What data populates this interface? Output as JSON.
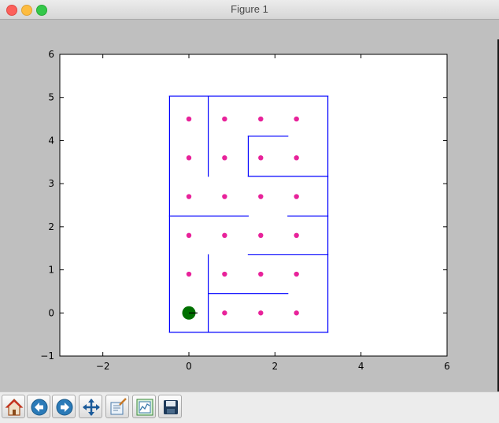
{
  "window": {
    "title": "Figure 1",
    "controls": [
      "close-button",
      "minimize-button",
      "zoom-button"
    ]
  },
  "chart_data": {
    "type": "scatter",
    "xlim": [
      -3,
      6
    ],
    "ylim": [
      -1,
      6
    ],
    "x_ticks": [
      -2,
      0,
      2,
      4,
      6
    ],
    "y_ticks": [
      -1,
      0,
      1,
      2,
      3,
      4,
      5,
      6
    ],
    "x_tick_labels": [
      "−2",
      "0",
      "2",
      "4",
      "6"
    ],
    "y_tick_labels": [
      "−1",
      "0",
      "1",
      "2",
      "3",
      "4",
      "5",
      "6"
    ],
    "grid": false,
    "points": {
      "color": "#e8229a",
      "x": [
        0,
        0.83,
        1.67,
        2.5
      ],
      "y": [
        0,
        0.9,
        1.8,
        2.7,
        3.6,
        4.5
      ],
      "omitted": [
        [
          0,
          0
        ]
      ]
    },
    "agent": {
      "x": 0,
      "y": 0,
      "color": "#007000",
      "heading": [
        0.2,
        0
      ]
    },
    "walls": {
      "color": "#0000ff",
      "segments": [
        [
          [
            -0.45,
            -0.45
          ],
          [
            3.23,
            -0.45
          ]
        ],
        [
          [
            3.23,
            -0.45
          ],
          [
            3.23,
            5.03
          ]
        ],
        [
          [
            3.23,
            5.03
          ],
          [
            -0.45,
            5.03
          ]
        ],
        [
          [
            -0.45,
            5.03
          ],
          [
            -0.45,
            -0.45
          ]
        ],
        [
          [
            0.45,
            5.03
          ],
          [
            0.45,
            3.17
          ]
        ],
        [
          [
            1.38,
            4.1
          ],
          [
            2.3,
            4.1
          ]
        ],
        [
          [
            1.38,
            4.1
          ],
          [
            1.38,
            3.17
          ]
        ],
        [
          [
            1.38,
            3.17
          ],
          [
            3.23,
            3.17
          ]
        ],
        [
          [
            -0.45,
            2.25
          ],
          [
            1.38,
            2.25
          ]
        ],
        [
          [
            2.3,
            2.25
          ],
          [
            3.23,
            2.25
          ]
        ],
        [
          [
            1.38,
            1.35
          ],
          [
            3.23,
            1.35
          ]
        ],
        [
          [
            0.45,
            1.35
          ],
          [
            0.45,
            -0.45
          ]
        ],
        [
          [
            0.45,
            0.45
          ],
          [
            2.3,
            0.45
          ]
        ]
      ]
    }
  },
  "toolbar": {
    "buttons": [
      {
        "name": "home-button",
        "icon": "home-icon"
      },
      {
        "name": "back-button",
        "icon": "back-arrow-icon"
      },
      {
        "name": "forward-button",
        "icon": "forward-arrow-icon"
      },
      {
        "name": "pan-button",
        "icon": "pan-move-icon"
      },
      {
        "name": "zoom-button",
        "icon": "zoom-rect-icon"
      },
      {
        "name": "subplots-button",
        "icon": "subplots-config-icon"
      },
      {
        "name": "save-button",
        "icon": "save-disk-icon"
      }
    ]
  }
}
